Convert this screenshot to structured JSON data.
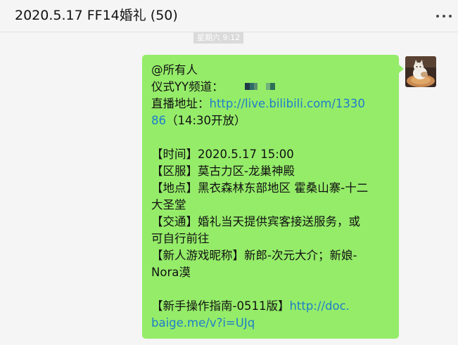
{
  "header": {
    "title": "2020.5.17 FF14婚礼 (50)",
    "more_icon": "more-horizontal-icon"
  },
  "chat": {
    "timestamp": "星期六 9:12",
    "message": {
      "line_mention": "@所有人",
      "yy_label": "仪式YY频道：",
      "stream_label": "直播地址：",
      "stream_url_line1": "http://live.bilibili.com/1330",
      "stream_url_line2": "86",
      "stream_open": "（14:30开放）",
      "time": "【时间】2020.5.17 15:00",
      "server": "【区服】莫古力区-龙巢神殿",
      "location_line1": "【地点】黑衣森林东部地区 霍桑山寨-十二",
      "location_line2": "大圣堂",
      "transport_line1": "【交通】婚礼当天提供宾客接送服务，或",
      "transport_line2": "可自行前往",
      "nickname_line1": "【新人游戏昵称】新郎-次元大介；新娘-",
      "nickname_line2": "Nora漠",
      "guide_label": "【新手操作指南-0511版】",
      "guide_url_line1": "http://doc.",
      "guide_url_line2": "baige.me/v?i=UJq"
    },
    "colors": {
      "bubble": "#95ec69",
      "link": "#1e7dc9",
      "background": "#f5f5f5"
    }
  }
}
